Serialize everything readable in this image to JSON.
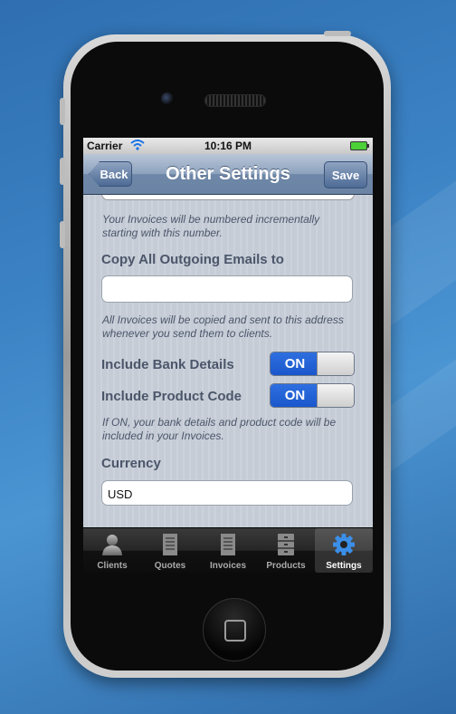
{
  "status": {
    "carrier": "Carrier",
    "time": "10:16 PM"
  },
  "nav": {
    "title": "Other Settings",
    "back": "Back",
    "save": "Save"
  },
  "form": {
    "invoice_number_hint": "Your Invoices will be numbered incrementally starting with this number.",
    "copy_emails_label": "Copy All Outgoing Emails to",
    "copy_emails_value": "",
    "copy_emails_hint": "All Invoices will be copied and sent to this address whenever you send them to clients.",
    "bank_details_label": "Include Bank Details",
    "bank_details_state": "ON",
    "product_code_label": "Include Product Code",
    "product_code_state": "ON",
    "toggles_hint": "If ON, your bank details and product code will be included in your Invoices.",
    "currency_label": "Currency",
    "currency_value": "USD"
  },
  "tabs": [
    {
      "label": "Clients",
      "icon": "person-icon",
      "active": false
    },
    {
      "label": "Quotes",
      "icon": "receipt-icon",
      "active": false
    },
    {
      "label": "Invoices",
      "icon": "receipt-icon",
      "active": false
    },
    {
      "label": "Products",
      "icon": "cabinet-icon",
      "active": false
    },
    {
      "label": "Settings",
      "icon": "gear-icon",
      "active": true
    }
  ],
  "colors": {
    "switch_on": "#1a57cc",
    "tab_active_icon": "#3b8fe8"
  }
}
